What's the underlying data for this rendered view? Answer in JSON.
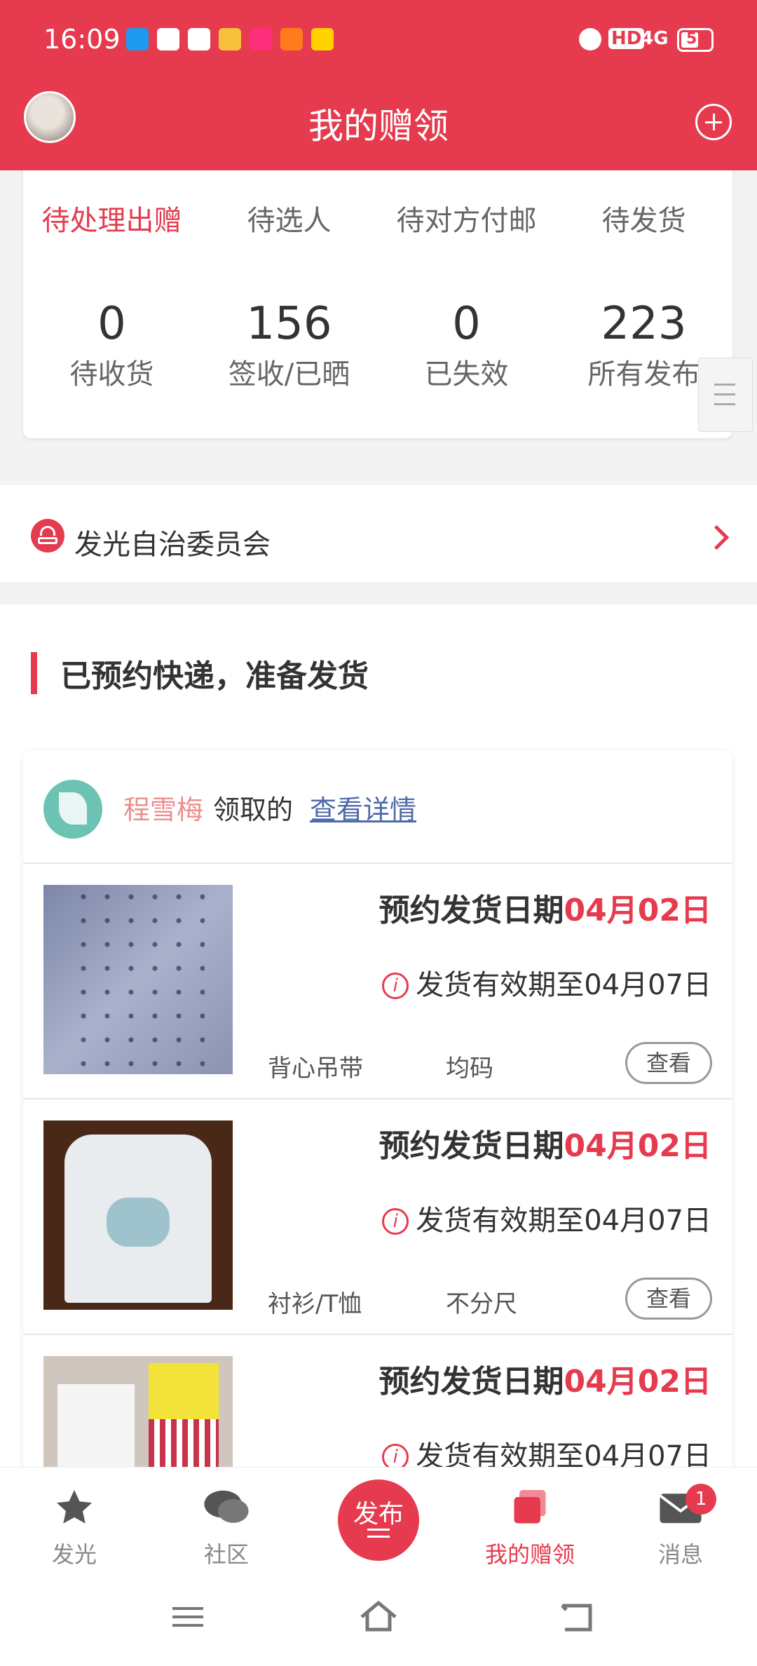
{
  "status_bar": {
    "time": "16:09",
    "network": "4G",
    "hd": "HD",
    "battery": "51",
    "app_icons": [
      "alipay-icon",
      "mail-icon",
      "star-icon",
      "chick-icon",
      "taobao-icon",
      "shop-icon",
      "meituan-icon"
    ]
  },
  "header": {
    "title": "我的赠领"
  },
  "stats": {
    "row1": [
      {
        "label": "待处理出赠"
      },
      {
        "label": "待选人"
      },
      {
        "label": "待对方付邮"
      },
      {
        "label": "待发货"
      }
    ],
    "row2": [
      {
        "value": "0",
        "label": "待收货"
      },
      {
        "value": "156",
        "label": "签收/已晒"
      },
      {
        "value": "0",
        "label": "已失效"
      },
      {
        "value": "223",
        "label": "所有发布"
      }
    ]
  },
  "committee": {
    "label": "发光自治委员会"
  },
  "section": {
    "title": "已预约快递，准备发货"
  },
  "order": {
    "recipient_name": "程雪梅",
    "received_text": "领取的",
    "detail_link": "查看详情",
    "items": [
      {
        "date_label": "预约发货日期",
        "date": "04月02日",
        "valid": "发货有效期至04月07日",
        "category": "背心吊带",
        "size": "均码",
        "button": "查看"
      },
      {
        "date_label": "预约发货日期",
        "date": "04月02日",
        "valid": "发货有效期至04月07日",
        "category": "衬衫/T恤",
        "size": "不分尺",
        "button": "查看"
      },
      {
        "date_label": "预约发货日期",
        "date": "04月02日",
        "valid": "发货有效期至04月07日"
      }
    ]
  },
  "nav": {
    "items": [
      {
        "label": "发光",
        "icon": "star-icon"
      },
      {
        "label": "社区",
        "icon": "chat-icon"
      },
      {
        "label": "发布",
        "icon": "publish-icon"
      },
      {
        "label": "我的赠领",
        "icon": "cards-icon"
      },
      {
        "label": "消息",
        "icon": "mail-icon"
      }
    ],
    "message_badge": "1"
  },
  "colors": {
    "accent": "#e63b4e",
    "link": "#4f6aa8",
    "recipient": "#ec8e8e"
  }
}
